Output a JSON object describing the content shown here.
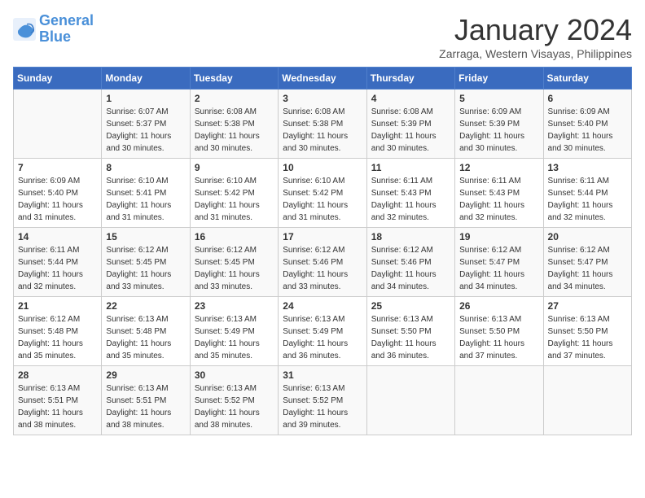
{
  "logo": {
    "line1": "General",
    "line2": "Blue"
  },
  "title": "January 2024",
  "subtitle": "Zarraga, Western Visayas, Philippines",
  "days_header": [
    "Sunday",
    "Monday",
    "Tuesday",
    "Wednesday",
    "Thursday",
    "Friday",
    "Saturday"
  ],
  "weeks": [
    [
      {
        "day": "",
        "info": ""
      },
      {
        "day": "1",
        "info": "Sunrise: 6:07 AM\nSunset: 5:37 PM\nDaylight: 11 hours\nand 30 minutes."
      },
      {
        "day": "2",
        "info": "Sunrise: 6:08 AM\nSunset: 5:38 PM\nDaylight: 11 hours\nand 30 minutes."
      },
      {
        "day": "3",
        "info": "Sunrise: 6:08 AM\nSunset: 5:38 PM\nDaylight: 11 hours\nand 30 minutes."
      },
      {
        "day": "4",
        "info": "Sunrise: 6:08 AM\nSunset: 5:39 PM\nDaylight: 11 hours\nand 30 minutes."
      },
      {
        "day": "5",
        "info": "Sunrise: 6:09 AM\nSunset: 5:39 PM\nDaylight: 11 hours\nand 30 minutes."
      },
      {
        "day": "6",
        "info": "Sunrise: 6:09 AM\nSunset: 5:40 PM\nDaylight: 11 hours\nand 30 minutes."
      }
    ],
    [
      {
        "day": "7",
        "info": "Sunrise: 6:09 AM\nSunset: 5:40 PM\nDaylight: 11 hours\nand 31 minutes."
      },
      {
        "day": "8",
        "info": "Sunrise: 6:10 AM\nSunset: 5:41 PM\nDaylight: 11 hours\nand 31 minutes."
      },
      {
        "day": "9",
        "info": "Sunrise: 6:10 AM\nSunset: 5:42 PM\nDaylight: 11 hours\nand 31 minutes."
      },
      {
        "day": "10",
        "info": "Sunrise: 6:10 AM\nSunset: 5:42 PM\nDaylight: 11 hours\nand 31 minutes."
      },
      {
        "day": "11",
        "info": "Sunrise: 6:11 AM\nSunset: 5:43 PM\nDaylight: 11 hours\nand 32 minutes."
      },
      {
        "day": "12",
        "info": "Sunrise: 6:11 AM\nSunset: 5:43 PM\nDaylight: 11 hours\nand 32 minutes."
      },
      {
        "day": "13",
        "info": "Sunrise: 6:11 AM\nSunset: 5:44 PM\nDaylight: 11 hours\nand 32 minutes."
      }
    ],
    [
      {
        "day": "14",
        "info": "Sunrise: 6:11 AM\nSunset: 5:44 PM\nDaylight: 11 hours\nand 32 minutes."
      },
      {
        "day": "15",
        "info": "Sunrise: 6:12 AM\nSunset: 5:45 PM\nDaylight: 11 hours\nand 33 minutes."
      },
      {
        "day": "16",
        "info": "Sunrise: 6:12 AM\nSunset: 5:45 PM\nDaylight: 11 hours\nand 33 minutes."
      },
      {
        "day": "17",
        "info": "Sunrise: 6:12 AM\nSunset: 5:46 PM\nDaylight: 11 hours\nand 33 minutes."
      },
      {
        "day": "18",
        "info": "Sunrise: 6:12 AM\nSunset: 5:46 PM\nDaylight: 11 hours\nand 34 minutes."
      },
      {
        "day": "19",
        "info": "Sunrise: 6:12 AM\nSunset: 5:47 PM\nDaylight: 11 hours\nand 34 minutes."
      },
      {
        "day": "20",
        "info": "Sunrise: 6:12 AM\nSunset: 5:47 PM\nDaylight: 11 hours\nand 34 minutes."
      }
    ],
    [
      {
        "day": "21",
        "info": "Sunrise: 6:12 AM\nSunset: 5:48 PM\nDaylight: 11 hours\nand 35 minutes."
      },
      {
        "day": "22",
        "info": "Sunrise: 6:13 AM\nSunset: 5:48 PM\nDaylight: 11 hours\nand 35 minutes."
      },
      {
        "day": "23",
        "info": "Sunrise: 6:13 AM\nSunset: 5:49 PM\nDaylight: 11 hours\nand 35 minutes."
      },
      {
        "day": "24",
        "info": "Sunrise: 6:13 AM\nSunset: 5:49 PM\nDaylight: 11 hours\nand 36 minutes."
      },
      {
        "day": "25",
        "info": "Sunrise: 6:13 AM\nSunset: 5:50 PM\nDaylight: 11 hours\nand 36 minutes."
      },
      {
        "day": "26",
        "info": "Sunrise: 6:13 AM\nSunset: 5:50 PM\nDaylight: 11 hours\nand 37 minutes."
      },
      {
        "day": "27",
        "info": "Sunrise: 6:13 AM\nSunset: 5:50 PM\nDaylight: 11 hours\nand 37 minutes."
      }
    ],
    [
      {
        "day": "28",
        "info": "Sunrise: 6:13 AM\nSunset: 5:51 PM\nDaylight: 11 hours\nand 38 minutes."
      },
      {
        "day": "29",
        "info": "Sunrise: 6:13 AM\nSunset: 5:51 PM\nDaylight: 11 hours\nand 38 minutes."
      },
      {
        "day": "30",
        "info": "Sunrise: 6:13 AM\nSunset: 5:52 PM\nDaylight: 11 hours\nand 38 minutes."
      },
      {
        "day": "31",
        "info": "Sunrise: 6:13 AM\nSunset: 5:52 PM\nDaylight: 11 hours\nand 39 minutes."
      },
      {
        "day": "",
        "info": ""
      },
      {
        "day": "",
        "info": ""
      },
      {
        "day": "",
        "info": ""
      }
    ]
  ]
}
